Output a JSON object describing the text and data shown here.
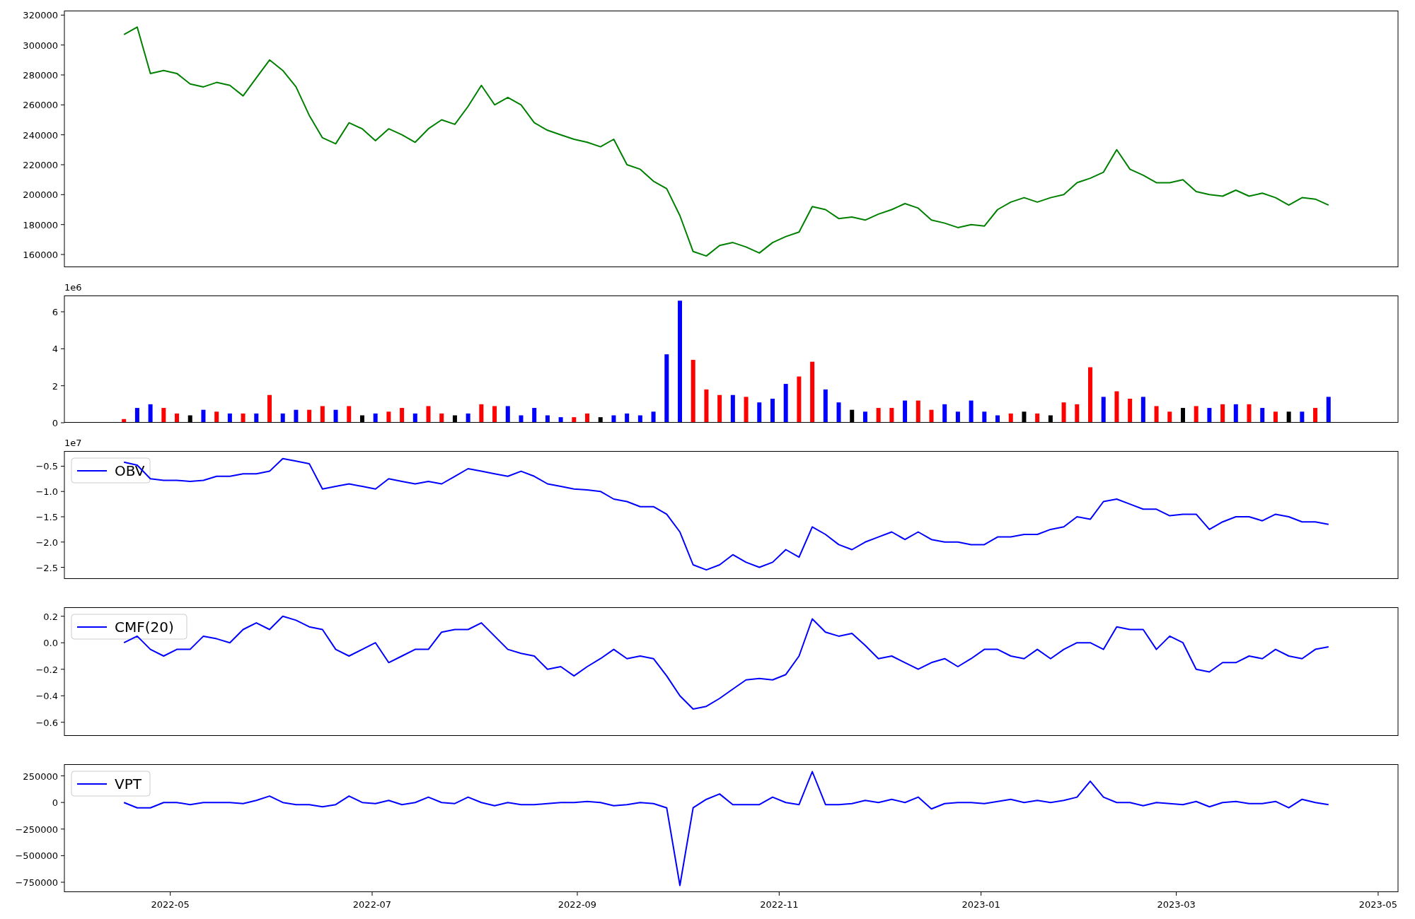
{
  "figure": {
    "panels": [
      {
        "chart_data": {
          "type": "line",
          "x": [
            "2022-04-17",
            "2022-04-21",
            "2022-04-25",
            "2022-04-29",
            "2022-05-03",
            "2022-05-07",
            "2022-05-11",
            "2022-05-15",
            "2022-05-19",
            "2022-05-23",
            "2022-05-27",
            "2022-05-31",
            "2022-06-04",
            "2022-06-08",
            "2022-06-12",
            "2022-06-16",
            "2022-06-20",
            "2022-06-24",
            "2022-06-28",
            "2022-07-02",
            "2022-07-06",
            "2022-07-10",
            "2022-07-14",
            "2022-07-18",
            "2022-07-22",
            "2022-07-26",
            "2022-07-30",
            "2022-08-03",
            "2022-08-07",
            "2022-08-11",
            "2022-08-15",
            "2022-08-19",
            "2022-08-23",
            "2022-08-27",
            "2022-08-31",
            "2022-09-04",
            "2022-09-08",
            "2022-09-12",
            "2022-09-16",
            "2022-09-20",
            "2022-09-24",
            "2022-09-28",
            "2022-10-02",
            "2022-10-06",
            "2022-10-10",
            "2022-10-14",
            "2022-10-18",
            "2022-10-22",
            "2022-10-26",
            "2022-10-30",
            "2022-11-03",
            "2022-11-07",
            "2022-11-11",
            "2022-11-15",
            "2022-11-19",
            "2022-11-23",
            "2022-11-27",
            "2022-12-01",
            "2022-12-05",
            "2022-12-09",
            "2022-12-13",
            "2022-12-17",
            "2022-12-21",
            "2022-12-25",
            "2022-12-29",
            "2023-01-02",
            "2023-01-06",
            "2023-01-10",
            "2023-01-14",
            "2023-01-18",
            "2023-01-22",
            "2023-01-26",
            "2023-01-30",
            "2023-02-03",
            "2023-02-07",
            "2023-02-11",
            "2023-02-15",
            "2023-02-19",
            "2023-02-23",
            "2023-02-27",
            "2023-03-03",
            "2023-03-07",
            "2023-03-11",
            "2023-03-15",
            "2023-03-19",
            "2023-03-23",
            "2023-03-27",
            "2023-03-31",
            "2023-04-04",
            "2023-04-08",
            "2023-04-12",
            "2023-04-16"
          ],
          "xlim": [
            "2022-03-30",
            "2023-05-07"
          ],
          "ylim": [
            151500,
            323000
          ],
          "yticks": [
            160000,
            180000,
            200000,
            220000,
            240000,
            260000,
            280000,
            300000,
            320000
          ],
          "series": [
            {
              "color": "#008000",
              "values": [
                307000,
                312000,
                281000,
                283000,
                281000,
                274000,
                272000,
                275000,
                273000,
                266000,
                278000,
                290000,
                283000,
                272000,
                253000,
                238000,
                234000,
                248000,
                244000,
                236000,
                244000,
                240000,
                235000,
                244000,
                250000,
                247000,
                259000,
                273000,
                260000,
                265000,
                260000,
                248000,
                243000,
                240000,
                237000,
                235000,
                232000,
                237000,
                220000,
                217000,
                209000,
                204000,
                186000,
                162000,
                159000,
                166000,
                168000,
                165000,
                161000,
                168000,
                172000,
                175000,
                192000,
                190000,
                184000,
                185000,
                183000,
                187000,
                190000,
                194000,
                191000,
                183000,
                181000,
                178000,
                180000,
                179000,
                190000,
                195000,
                198000,
                195000,
                198000,
                200000,
                208000,
                211000,
                215000,
                230000,
                217000,
                213000,
                208000,
                208000,
                210000,
                202000,
                200000,
                199000,
                203000,
                199000,
                201000,
                198000,
                193000,
                198000,
                197000,
                193000
              ]
            }
          ]
        }
      },
      {
        "axis_offset": "1e6",
        "chart_data": {
          "type": "bar",
          "x": [
            "2022-04-17",
            "2022-04-21",
            "2022-04-25",
            "2022-04-29",
            "2022-05-03",
            "2022-05-07",
            "2022-05-11",
            "2022-05-15",
            "2022-05-19",
            "2022-05-23",
            "2022-05-27",
            "2022-05-31",
            "2022-06-04",
            "2022-06-08",
            "2022-06-12",
            "2022-06-16",
            "2022-06-20",
            "2022-06-24",
            "2022-06-28",
            "2022-07-02",
            "2022-07-06",
            "2022-07-10",
            "2022-07-14",
            "2022-07-18",
            "2022-07-22",
            "2022-07-26",
            "2022-07-30",
            "2022-08-03",
            "2022-08-07",
            "2022-08-11",
            "2022-08-15",
            "2022-08-19",
            "2022-08-23",
            "2022-08-27",
            "2022-08-31",
            "2022-09-04",
            "2022-09-08",
            "2022-09-12",
            "2022-09-16",
            "2022-09-20",
            "2022-09-24",
            "2022-09-28",
            "2022-10-02",
            "2022-10-06",
            "2022-10-10",
            "2022-10-14",
            "2022-10-18",
            "2022-10-22",
            "2022-10-26",
            "2022-10-30",
            "2022-11-03",
            "2022-11-07",
            "2022-11-11",
            "2022-11-15",
            "2022-11-19",
            "2022-11-23",
            "2022-11-27",
            "2022-12-01",
            "2022-12-05",
            "2022-12-09",
            "2022-12-13",
            "2022-12-17",
            "2022-12-21",
            "2022-12-25",
            "2022-12-29",
            "2023-01-02",
            "2023-01-06",
            "2023-01-10",
            "2023-01-14",
            "2023-01-18",
            "2023-01-22",
            "2023-01-26",
            "2023-01-30",
            "2023-02-03",
            "2023-02-07",
            "2023-02-11",
            "2023-02-15",
            "2023-02-19",
            "2023-02-23",
            "2023-02-27",
            "2023-03-03",
            "2023-03-07",
            "2023-03-11",
            "2023-03-15",
            "2023-03-19",
            "2023-03-23",
            "2023-03-27",
            "2023-03-31",
            "2023-04-04",
            "2023-04-08",
            "2023-04-12",
            "2023-04-16"
          ],
          "xlim": [
            "2022-03-30",
            "2023-05-07"
          ],
          "ylim": [
            0,
            6.88
          ],
          "yticks": [
            0,
            2,
            4,
            6
          ],
          "series": [
            {
              "color": "#ff0000",
              "values": [
                0.2,
                null,
                null,
                0.8,
                0.5,
                null,
                null,
                0.6,
                null,
                0.5,
                null,
                1.5,
                null,
                null,
                0.7,
                0.9,
                null,
                0.9,
                null,
                null,
                0.6,
                0.8,
                null,
                0.9,
                0.5,
                null,
                null,
                1.0,
                0.9,
                null,
                null,
                null,
                null,
                null,
                0.3,
                0.5,
                null,
                null,
                null,
                null,
                null,
                null,
                null,
                3.4,
                1.8,
                1.5,
                null,
                1.4,
                null,
                null,
                null,
                2.5,
                3.3,
                null,
                null,
                null,
                null,
                0.8,
                0.8,
                null,
                1.2,
                0.7,
                null,
                null,
                null,
                null,
                null,
                0.5,
                null,
                0.5,
                null,
                1.1,
                1.0,
                3.0,
                null,
                1.7,
                1.3,
                null,
                0.9,
                0.6,
                null,
                0.9,
                null,
                1.0,
                null,
                1.0,
                null,
                0.6,
                null,
                null,
                0.8,
                null
              ]
            },
            {
              "color": "#0000ff",
              "values": [
                null,
                0.8,
                1.0,
                null,
                null,
                null,
                0.7,
                null,
                0.5,
                null,
                0.5,
                null,
                0.5,
                0.7,
                null,
                null,
                0.7,
                null,
                null,
                0.5,
                null,
                null,
                0.5,
                null,
                null,
                null,
                0.5,
                null,
                null,
                0.9,
                0.4,
                0.8,
                0.4,
                0.3,
                null,
                null,
                null,
                0.4,
                0.5,
                0.4,
                0.6,
                3.7,
                6.6,
                null,
                null,
                null,
                1.5,
                null,
                1.1,
                1.3,
                2.1,
                null,
                null,
                1.8,
                1.1,
                null,
                0.6,
                null,
                null,
                1.2,
                null,
                null,
                1.0,
                0.6,
                1.2,
                0.6,
                0.4,
                null,
                null,
                null,
                null,
                null,
                null,
                null,
                1.4,
                null,
                null,
                1.4,
                null,
                null,
                null,
                null,
                0.8,
                null,
                1.0,
                null,
                0.8,
                null,
                null,
                0.6,
                null,
                1.4
              ]
            },
            {
              "color": "#000000",
              "values": [
                null,
                null,
                null,
                null,
                null,
                0.4,
                null,
                null,
                null,
                null,
                null,
                null,
                null,
                null,
                null,
                null,
                null,
                null,
                0.4,
                null,
                null,
                null,
                null,
                null,
                null,
                0.4,
                null,
                null,
                null,
                null,
                null,
                null,
                null,
                null,
                null,
                null,
                0.3,
                null,
                null,
                null,
                null,
                null,
                null,
                null,
                null,
                null,
                null,
                null,
                null,
                null,
                null,
                null,
                null,
                null,
                null,
                0.7,
                null,
                null,
                null,
                null,
                null,
                null,
                null,
                null,
                null,
                null,
                null,
                null,
                0.6,
                null,
                0.4,
                null,
                null,
                null,
                null,
                null,
                null,
                null,
                null,
                null,
                0.8,
                null,
                null,
                null,
                null,
                null,
                null,
                null,
                0.6,
                null,
                null,
                null
              ]
            }
          ]
        }
      },
      {
        "axis_offset": "1e7",
        "chart_data": {
          "type": "line",
          "x": [
            "2022-04-17",
            "2022-04-21",
            "2022-04-25",
            "2022-04-29",
            "2022-05-03",
            "2022-05-07",
            "2022-05-11",
            "2022-05-15",
            "2022-05-19",
            "2022-05-23",
            "2022-05-27",
            "2022-05-31",
            "2022-06-04",
            "2022-06-08",
            "2022-06-12",
            "2022-06-16",
            "2022-06-20",
            "2022-06-24",
            "2022-06-28",
            "2022-07-02",
            "2022-07-06",
            "2022-07-10",
            "2022-07-14",
            "2022-07-18",
            "2022-07-22",
            "2022-07-26",
            "2022-07-30",
            "2022-08-03",
            "2022-08-07",
            "2022-08-11",
            "2022-08-15",
            "2022-08-19",
            "2022-08-23",
            "2022-08-27",
            "2022-08-31",
            "2022-09-04",
            "2022-09-08",
            "2022-09-12",
            "2022-09-16",
            "2022-09-20",
            "2022-09-24",
            "2022-09-28",
            "2022-10-02",
            "2022-10-06",
            "2022-10-10",
            "2022-10-14",
            "2022-10-18",
            "2022-10-22",
            "2022-10-26",
            "2022-10-30",
            "2022-11-03",
            "2022-11-07",
            "2022-11-11",
            "2022-11-15",
            "2022-11-19",
            "2022-11-23",
            "2022-11-27",
            "2022-12-01",
            "2022-12-05",
            "2022-12-09",
            "2022-12-13",
            "2022-12-17",
            "2022-12-21",
            "2022-12-25",
            "2022-12-29",
            "2023-01-02",
            "2023-01-06",
            "2023-01-10",
            "2023-01-14",
            "2023-01-18",
            "2023-01-22",
            "2023-01-26",
            "2023-01-30",
            "2023-02-03",
            "2023-02-07",
            "2023-02-11",
            "2023-02-15",
            "2023-02-19",
            "2023-02-23",
            "2023-02-27",
            "2023-03-03",
            "2023-03-07",
            "2023-03-11",
            "2023-03-15",
            "2023-03-19",
            "2023-03-23",
            "2023-03-27",
            "2023-03-31",
            "2023-04-04",
            "2023-04-08",
            "2023-04-12",
            "2023-04-16"
          ],
          "xlim": [
            "2022-03-30",
            "2023-05-07"
          ],
          "ylim": [
            -2.73,
            -0.2
          ],
          "yticks": [
            {
              "value": -2.5,
              "label": "−2.5"
            },
            {
              "value": -2.0,
              "label": "−2.0"
            },
            {
              "value": -1.5,
              "label": "−1.5"
            },
            {
              "value": -1.0,
              "label": "−1.0"
            },
            {
              "value": -0.5,
              "label": "−0.5"
            }
          ],
          "series": [
            {
              "name": "OBV",
              "color": "#0000ff",
              "values": [
                -0.42,
                -0.48,
                -0.75,
                -0.78,
                -0.78,
                -0.8,
                -0.78,
                -0.7,
                -0.7,
                -0.65,
                -0.65,
                -0.6,
                -0.35,
                -0.4,
                -0.45,
                -0.95,
                -0.9,
                -0.85,
                -0.9,
                -0.95,
                -0.75,
                -0.8,
                -0.85,
                -0.8,
                -0.85,
                -0.7,
                -0.55,
                -0.6,
                -0.65,
                -0.7,
                -0.6,
                -0.7,
                -0.85,
                -0.9,
                -0.95,
                -0.97,
                -1.0,
                -1.15,
                -1.2,
                -1.3,
                -1.3,
                -1.45,
                -1.8,
                -2.45,
                -2.55,
                -2.45,
                -2.25,
                -2.4,
                -2.5,
                -2.4,
                -2.15,
                -2.3,
                -1.7,
                -1.85,
                -2.05,
                -2.15,
                -2.0,
                -1.9,
                -1.8,
                -1.95,
                -1.8,
                -1.95,
                -2.0,
                -2.0,
                -2.05,
                -2.05,
                -1.9,
                -1.9,
                -1.85,
                -1.85,
                -1.75,
                -1.7,
                -1.5,
                -1.55,
                -1.2,
                -1.15,
                -1.25,
                -1.35,
                -1.35,
                -1.48,
                -1.45,
                -1.45,
                -1.75,
                -1.6,
                -1.5,
                -1.5,
                -1.58,
                -1.45,
                -1.5,
                -1.6,
                -1.6,
                -1.65
              ]
            }
          ]
        }
      },
      {
        "chart_data": {
          "type": "line",
          "x": [
            "2022-04-17",
            "2022-04-21",
            "2022-04-25",
            "2022-04-29",
            "2022-05-03",
            "2022-05-07",
            "2022-05-11",
            "2022-05-15",
            "2022-05-19",
            "2022-05-23",
            "2022-05-27",
            "2022-05-31",
            "2022-06-04",
            "2022-06-08",
            "2022-06-12",
            "2022-06-16",
            "2022-06-20",
            "2022-06-24",
            "2022-06-28",
            "2022-07-02",
            "2022-07-06",
            "2022-07-10",
            "2022-07-14",
            "2022-07-18",
            "2022-07-22",
            "2022-07-26",
            "2022-07-30",
            "2022-08-03",
            "2022-08-07",
            "2022-08-11",
            "2022-08-15",
            "2022-08-19",
            "2022-08-23",
            "2022-08-27",
            "2022-08-31",
            "2022-09-04",
            "2022-09-08",
            "2022-09-12",
            "2022-09-16",
            "2022-09-20",
            "2022-09-24",
            "2022-09-28",
            "2022-10-02",
            "2022-10-06",
            "2022-10-10",
            "2022-10-14",
            "2022-10-18",
            "2022-10-22",
            "2022-10-26",
            "2022-10-30",
            "2022-11-03",
            "2022-11-07",
            "2022-11-11",
            "2022-11-15",
            "2022-11-19",
            "2022-11-23",
            "2022-11-27",
            "2022-12-01",
            "2022-12-05",
            "2022-12-09",
            "2022-12-13",
            "2022-12-17",
            "2022-12-21",
            "2022-12-25",
            "2022-12-29",
            "2023-01-02",
            "2023-01-06",
            "2023-01-10",
            "2023-01-14",
            "2023-01-18",
            "2023-01-22",
            "2023-01-26",
            "2023-01-30",
            "2023-02-03",
            "2023-02-07",
            "2023-02-11",
            "2023-02-15",
            "2023-02-19",
            "2023-02-23",
            "2023-02-27",
            "2023-03-03",
            "2023-03-07",
            "2023-03-11",
            "2023-03-15",
            "2023-03-19",
            "2023-03-23",
            "2023-03-27",
            "2023-03-31",
            "2023-04-04",
            "2023-04-08",
            "2023-04-12",
            "2023-04-16"
          ],
          "xlim": [
            "2022-03-30",
            "2023-05-07"
          ],
          "ylim": [
            -0.703,
            0.268
          ],
          "yticks": [
            {
              "value": -0.6,
              "label": "−0.6"
            },
            {
              "value": -0.4,
              "label": "−0.4"
            },
            {
              "value": -0.2,
              "label": "−0.2"
            },
            {
              "value": 0.0,
              "label": "0.0"
            },
            {
              "value": 0.2,
              "label": "0.2"
            }
          ],
          "series": [
            {
              "name": "CMF(20)",
              "color": "#0000ff",
              "values": [
                0.0,
                0.05,
                -0.05,
                -0.1,
                -0.05,
                -0.05,
                0.05,
                0.03,
                0.0,
                0.1,
                0.15,
                0.1,
                0.2,
                0.17,
                0.12,
                0.1,
                -0.05,
                -0.1,
                -0.05,
                0.0,
                -0.15,
                -0.1,
                -0.05,
                -0.05,
                0.08,
                0.1,
                0.1,
                0.15,
                0.05,
                -0.05,
                -0.08,
                -0.1,
                -0.2,
                -0.18,
                -0.25,
                -0.18,
                -0.12,
                -0.05,
                -0.12,
                -0.1,
                -0.12,
                -0.25,
                -0.4,
                -0.5,
                -0.48,
                -0.42,
                -0.35,
                -0.28,
                -0.27,
                -0.28,
                -0.24,
                -0.1,
                0.18,
                0.08,
                0.05,
                0.07,
                -0.02,
                -0.12,
                -0.1,
                -0.15,
                -0.2,
                -0.15,
                -0.12,
                -0.18,
                -0.12,
                -0.05,
                -0.05,
                -0.1,
                -0.12,
                -0.05,
                -0.12,
                -0.05,
                0.0,
                0.0,
                -0.05,
                0.12,
                0.1,
                0.1,
                -0.05,
                0.05,
                0.0,
                -0.2,
                -0.22,
                -0.15,
                -0.15,
                -0.1,
                -0.12,
                -0.05,
                -0.1,
                -0.12,
                -0.05,
                -0.03
              ]
            }
          ]
        }
      },
      {
        "chart_data": {
          "type": "line",
          "x": [
            "2022-04-17",
            "2022-04-21",
            "2022-04-25",
            "2022-04-29",
            "2022-05-03",
            "2022-05-07",
            "2022-05-11",
            "2022-05-15",
            "2022-05-19",
            "2022-05-23",
            "2022-05-27",
            "2022-05-31",
            "2022-06-04",
            "2022-06-08",
            "2022-06-12",
            "2022-06-16",
            "2022-06-20",
            "2022-06-24",
            "2022-06-28",
            "2022-07-02",
            "2022-07-06",
            "2022-07-10",
            "2022-07-14",
            "2022-07-18",
            "2022-07-22",
            "2022-07-26",
            "2022-07-30",
            "2022-08-03",
            "2022-08-07",
            "2022-08-11",
            "2022-08-15",
            "2022-08-19",
            "2022-08-23",
            "2022-08-27",
            "2022-08-31",
            "2022-09-04",
            "2022-09-08",
            "2022-09-12",
            "2022-09-16",
            "2022-09-20",
            "2022-09-24",
            "2022-09-28",
            "2022-10-02",
            "2022-10-06",
            "2022-10-10",
            "2022-10-14",
            "2022-10-18",
            "2022-10-22",
            "2022-10-26",
            "2022-10-30",
            "2022-11-03",
            "2022-11-07",
            "2022-11-11",
            "2022-11-15",
            "2022-11-19",
            "2022-11-23",
            "2022-11-27",
            "2022-12-01",
            "2022-12-05",
            "2022-12-09",
            "2022-12-13",
            "2022-12-17",
            "2022-12-21",
            "2022-12-25",
            "2022-12-29",
            "2023-01-02",
            "2023-01-06",
            "2023-01-10",
            "2023-01-14",
            "2023-01-18",
            "2023-01-22",
            "2023-01-26",
            "2023-01-30",
            "2023-02-03",
            "2023-02-07",
            "2023-02-11",
            "2023-02-15",
            "2023-02-19",
            "2023-02-23",
            "2023-02-27",
            "2023-03-03",
            "2023-03-07",
            "2023-03-11",
            "2023-03-15",
            "2023-03-19",
            "2023-03-23",
            "2023-03-27",
            "2023-03-31",
            "2023-04-04",
            "2023-04-08",
            "2023-04-12",
            "2023-04-16"
          ],
          "xlim": [
            "2022-03-30",
            "2023-05-07"
          ],
          "ylim": [
            -843000,
            360000
          ],
          "yticks": [
            {
              "value": -750000,
              "label": "−750000"
            },
            {
              "value": -500000,
              "label": "−500000"
            },
            {
              "value": -250000,
              "label": "−250000"
            },
            {
              "value": 0,
              "label": "0"
            },
            {
              "value": 250000,
              "label": "250000"
            }
          ],
          "xticks": [
            {
              "value": "2022-05-01",
              "label": "2022-05"
            },
            {
              "value": "2022-07-01",
              "label": "2022-07"
            },
            {
              "value": "2022-09-01",
              "label": "2022-09"
            },
            {
              "value": "2022-11-01",
              "label": "2022-11"
            },
            {
              "value": "2023-01-01",
              "label": "2023-01"
            },
            {
              "value": "2023-03-01",
              "label": "2023-03"
            },
            {
              "value": "2023-05-01",
              "label": "2023-05"
            }
          ],
          "series": [
            {
              "name": "VPT",
              "color": "#0000ff",
              "values": [
                0,
                -50000,
                -50000,
                0,
                0,
                -20000,
                0,
                0,
                0,
                -10000,
                20000,
                60000,
                0,
                -20000,
                -20000,
                -40000,
                -20000,
                60000,
                0,
                -10000,
                20000,
                -20000,
                0,
                50000,
                0,
                -10000,
                50000,
                0,
                -30000,
                0,
                -20000,
                -20000,
                -10000,
                0,
                0,
                10000,
                0,
                -30000,
                -20000,
                0,
                -10000,
                -50000,
                -780000,
                -50000,
                30000,
                80000,
                -20000,
                -20000,
                -20000,
                50000,
                0,
                -20000,
                290000,
                -20000,
                -20000,
                -10000,
                20000,
                0,
                30000,
                0,
                50000,
                -60000,
                -10000,
                0,
                0,
                -10000,
                10000,
                30000,
                0,
                20000,
                0,
                20000,
                50000,
                200000,
                50000,
                0,
                0,
                -30000,
                0,
                -10000,
                -20000,
                10000,
                -40000,
                0,
                10000,
                -10000,
                -10000,
                10000,
                -50000,
                30000,
                0,
                -20000
              ]
            }
          ]
        }
      }
    ]
  }
}
